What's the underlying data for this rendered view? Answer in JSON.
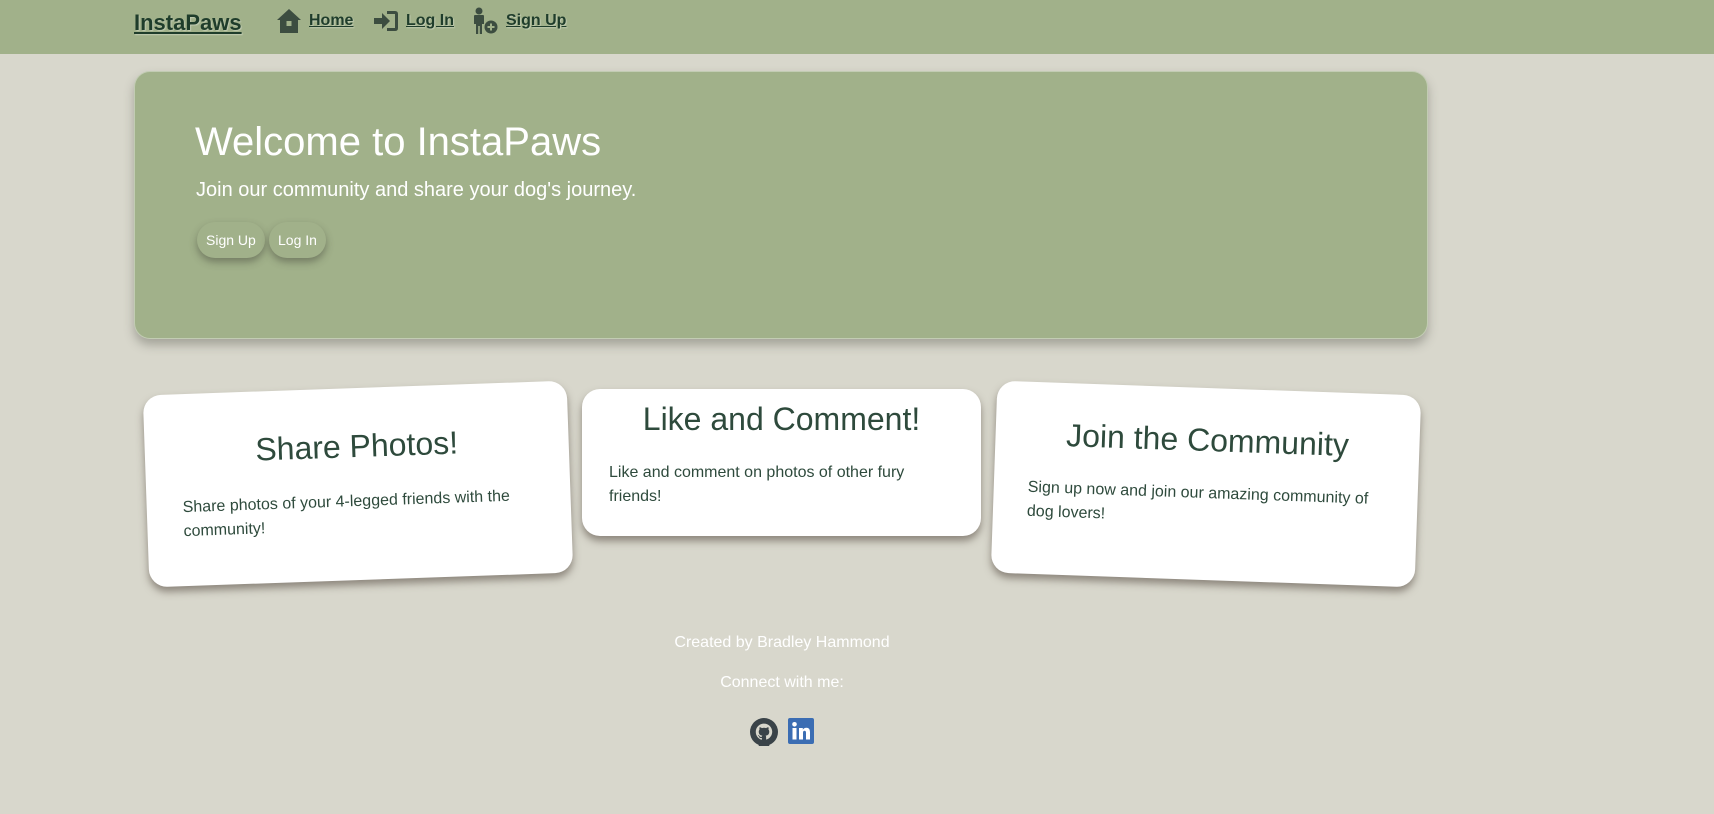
{
  "navbar": {
    "brand": "InstaPaws",
    "background_color": "#a1b18a",
    "links": [
      {
        "label": "Home",
        "icon": "home-icon"
      },
      {
        "label": "Log In",
        "icon": "login-icon"
      },
      {
        "label": "Sign Up",
        "icon": "user-add-icon"
      }
    ]
  },
  "hero": {
    "title": "Welcome to InstaPaws",
    "subtitle": "Join our community and share your dog's journey.",
    "buttons": {
      "signup_label": "Sign Up",
      "login_label": "Log In"
    }
  },
  "features": [
    {
      "title": "Share Photos!",
      "text": "Share photos of your 4-legged friends with the community!"
    },
    {
      "title": "Like and Comment!",
      "text": "Like and comment on photos of other fury friends!"
    },
    {
      "title": "Join the Community",
      "text": "Sign up now and join our amazing community of dog lovers!"
    }
  ],
  "footer": {
    "created_by": "Created by Bradley Hammond",
    "connect": "Connect with me:",
    "social": [
      {
        "icon": "github-icon"
      },
      {
        "icon": "linkedin-icon"
      }
    ]
  },
  "colors": {
    "page_background": "#d8d7cc",
    "accent_green": "#a1b18a",
    "dark_green_text": "#2e4a3c",
    "linkedin_blue": "#3b6db3"
  }
}
